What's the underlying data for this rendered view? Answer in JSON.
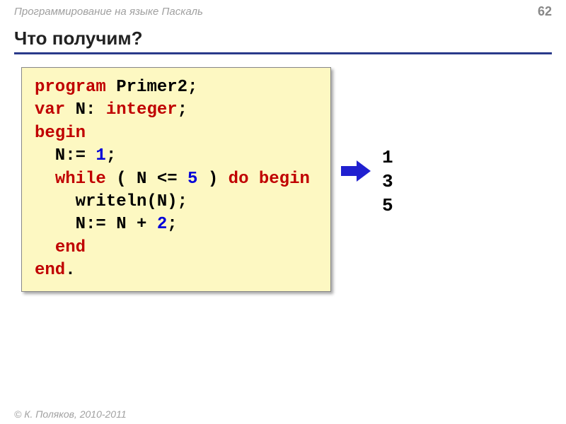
{
  "header": {
    "topic": "Программирование на языке Паскаль",
    "page_num": "62"
  },
  "title": "Что получим?",
  "code": {
    "l1_kw": "program",
    "l1_rest": " Primer2;",
    "l2_kw": "var",
    "l2_var": " N: ",
    "l2_type": "integer",
    "l2_end": ";",
    "l3_kw": "begin",
    "l4_pre": "  N:= ",
    "l4_val": "1",
    "l4_end": ";",
    "l5_pre": "  ",
    "l5_kw1": "while",
    "l5_mid": " ( N <= ",
    "l5_val": "5",
    "l5_mid2": " ) ",
    "l5_kw2": "do begin",
    "l6": "    writeln(N);",
    "l7_pre": "    N:= N + ",
    "l7_val": "2",
    "l7_end": ";",
    "l8_pre": "  ",
    "l8_kw": "end",
    "l9_kw": "end",
    "l9_end": "."
  },
  "output": {
    "o1": "1",
    "o2": "3",
    "o3": "5"
  },
  "footer": "© К. Поляков, 2010-2011"
}
